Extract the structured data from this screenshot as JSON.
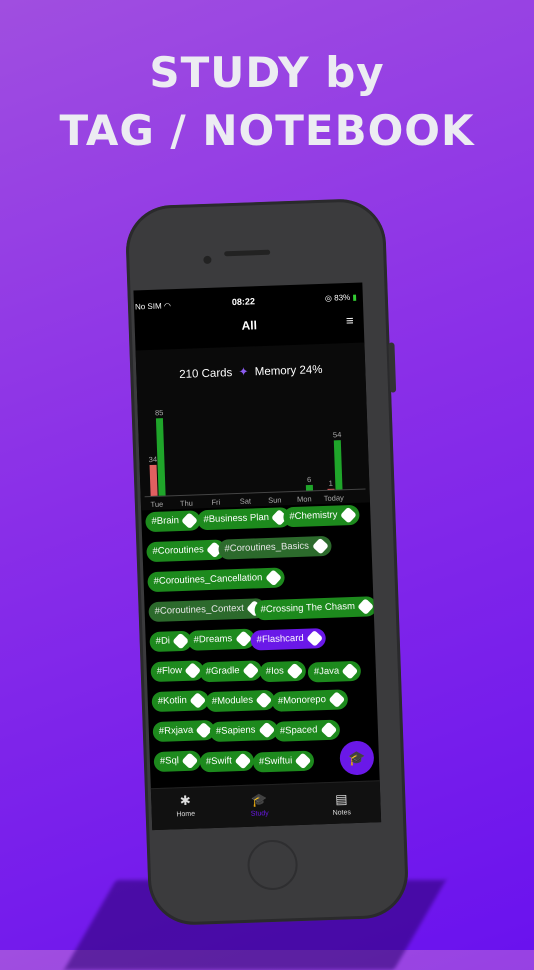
{
  "headline": {
    "line1": "STUDY by",
    "line2": "TAG / NOTEBOOK"
  },
  "status": {
    "carrier": "No SIM",
    "time": "08:22",
    "battery": "83%"
  },
  "nav": {
    "title": "All"
  },
  "summary": {
    "cards": "210 Cards",
    "memory": "Memory 24%"
  },
  "chart_data": {
    "type": "bar",
    "categories": [
      "Tue",
      "Thu",
      "Fri",
      "Sat",
      "Sun",
      "Mon",
      "Today"
    ],
    "series": [
      {
        "values": [
          34,
          0,
          0,
          0,
          0,
          0,
          1
        ],
        "color": "#e06060"
      },
      {
        "values": [
          85,
          0,
          0,
          0,
          0,
          6,
          54
        ],
        "color": "#1fa52a"
      }
    ],
    "labels": [
      "34",
      "85",
      "6",
      "1",
      "54"
    ],
    "ylim": [
      0,
      90
    ]
  },
  "tags": [
    {
      "label": "#Brain"
    },
    {
      "label": "#Business Plan"
    },
    {
      "label": "#Chemistry"
    },
    {
      "label": "#Coroutines"
    },
    {
      "label": "#Coroutines_Basics"
    },
    {
      "label": "#Coroutines_Cancellation"
    },
    {
      "label": "#Coroutines_Context"
    },
    {
      "label": "#Crossing The Chasm"
    },
    {
      "label": "#Di"
    },
    {
      "label": "#Dreams"
    },
    {
      "label": "#Flashcard"
    },
    {
      "label": "#Flow"
    },
    {
      "label": "#Gradle"
    },
    {
      "label": "#Ios"
    },
    {
      "label": "#Java"
    },
    {
      "label": "#Kotlin"
    },
    {
      "label": "#Modules"
    },
    {
      "label": "#Monorepo"
    },
    {
      "label": "#Rxjava"
    },
    {
      "label": "#Sapiens"
    },
    {
      "label": "#Spaced"
    },
    {
      "label": "#Sql"
    },
    {
      "label": "#Swift"
    },
    {
      "label": "#Swiftui"
    }
  ],
  "tabs": [
    {
      "label": "Home",
      "icon": "logo-icon"
    },
    {
      "label": "Study",
      "icon": "graduation-cap-icon"
    },
    {
      "label": "Notes",
      "icon": "notes-icon"
    }
  ],
  "colors": {
    "accent": "#6a18e8",
    "tag_green": "#1d8a1d",
    "bar_green": "#1fa52a",
    "bar_red": "#e06060"
  }
}
